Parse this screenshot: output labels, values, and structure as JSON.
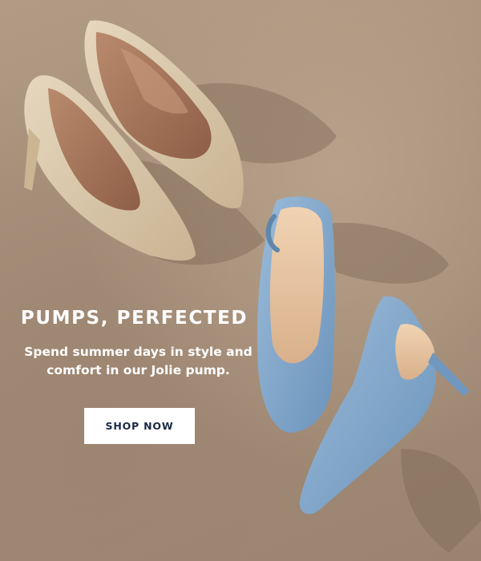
{
  "hero": {
    "headline": "PUMPS, PERFECTED",
    "subtext": "Spend summer days in style and comfort in our Jolie pump.",
    "cta_label": "SHOP NOW",
    "colors": {
      "background": "#a8917b",
      "text": "#ffffff",
      "button_bg": "#ffffff",
      "button_text": "#1b2944",
      "raffia_shoe": "#d8c6a8",
      "denim_shoe": "#7fa6c9"
    }
  }
}
